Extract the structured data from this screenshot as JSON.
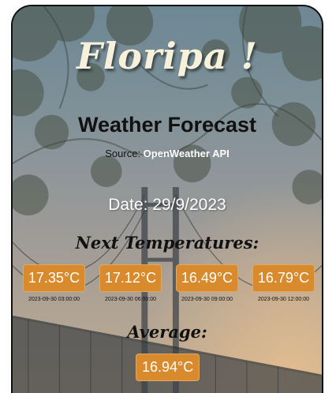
{
  "header": {
    "app_title": "Floripa !",
    "subtitle": "Weather Forecast",
    "source_label": "Source: ",
    "source_link": "OpenWeather API"
  },
  "date_label": "Date: 29/9/2023",
  "next": {
    "heading": "Next Temperatures:",
    "items": [
      {
        "temp": "17.35°C",
        "time": "2023-09-30 03:00:00"
      },
      {
        "temp": "17.12°C",
        "time": "2023-09-30 06:00:00"
      },
      {
        "temp": "16.49°C",
        "time": "2023-09-30 09:00:00"
      },
      {
        "temp": "16.79°C",
        "time": "2023-09-30 12:00:00"
      }
    ]
  },
  "average": {
    "heading": "Average:",
    "value": "16.94°C"
  },
  "colors": {
    "badge": "#d98a2c",
    "title": "#f7f1dc"
  }
}
